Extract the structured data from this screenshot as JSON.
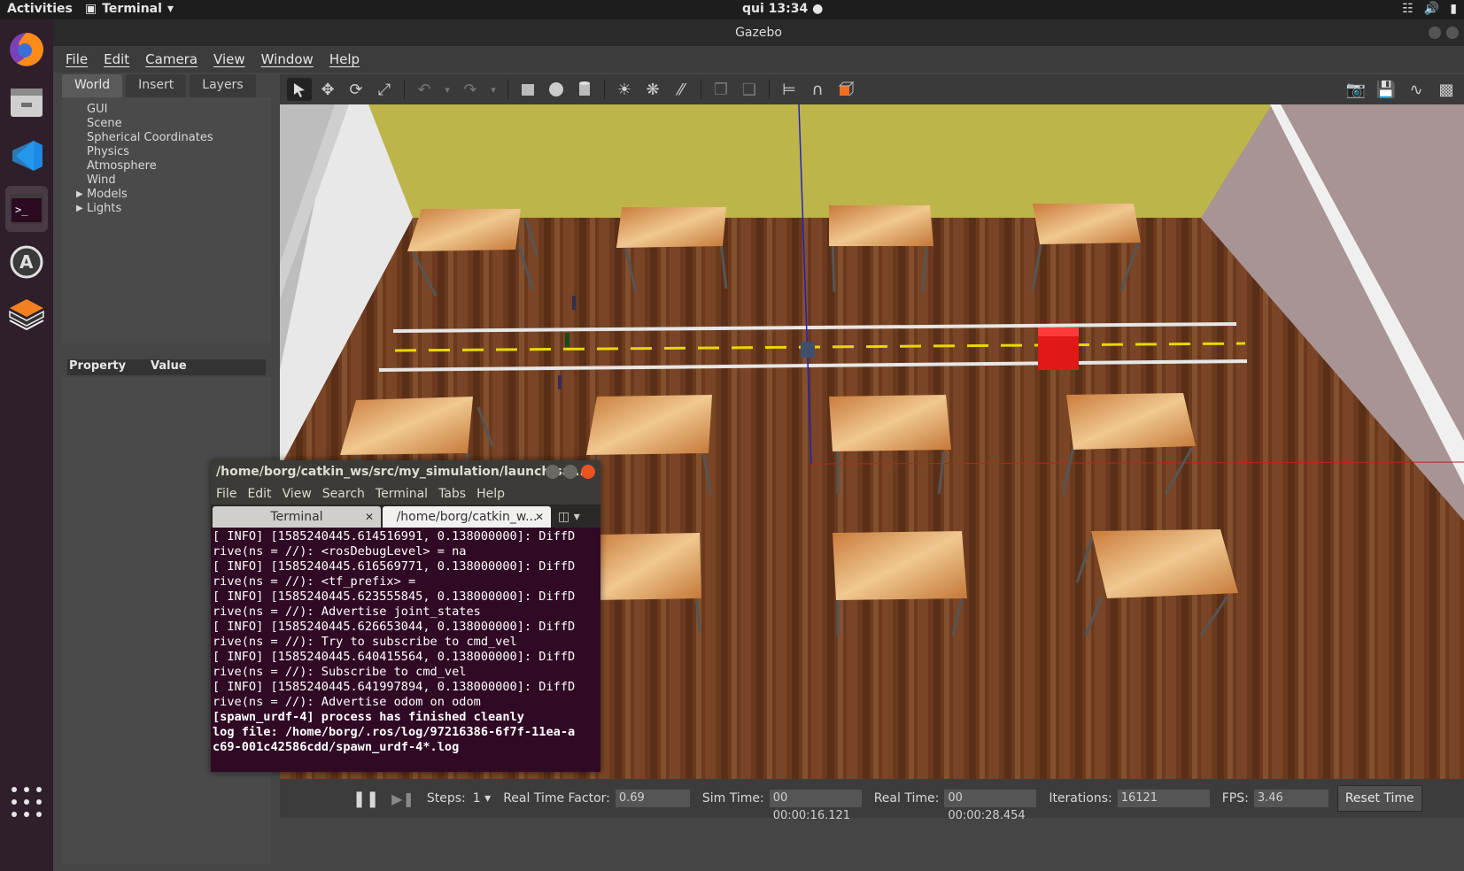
{
  "topbar": {
    "activities": "Activities",
    "app_menu": "Terminal",
    "clock": "qui 13:34"
  },
  "dock": {
    "apps": [
      {
        "name": "firefox-icon"
      },
      {
        "name": "files-icon"
      },
      {
        "name": "vscode-icon"
      },
      {
        "name": "terminal-icon"
      },
      {
        "name": "software-updater-icon"
      },
      {
        "name": "gazebo-icon"
      }
    ]
  },
  "gazebo": {
    "title": "Gazebo",
    "menu": [
      "File",
      "Edit",
      "Camera",
      "View",
      "Window",
      "Help"
    ],
    "tabs": [
      "World",
      "Insert",
      "Layers"
    ],
    "tree": [
      "GUI",
      "Scene",
      "Spherical Coordinates",
      "Physics",
      "Atmosphere",
      "Wind",
      "Models",
      "Lights"
    ],
    "property_header": {
      "property": "Property",
      "value": "Value"
    },
    "bottombar": {
      "steps_label": "Steps:",
      "steps_value": "1",
      "rtf_label": "Real Time Factor:",
      "rtf_value": "0.69",
      "sim_time_label": "Sim Time:",
      "sim_time_value": "00 00:00:16.121",
      "real_time_label": "Real Time:",
      "real_time_value": "00 00:00:28.454",
      "iterations_label": "Iterations:",
      "iterations_value": "16121",
      "fps_label": "FPS:",
      "fps_value": "3.46",
      "reset_label": "Reset Time"
    }
  },
  "terminal": {
    "title": "/home/borg/catkin_ws/src/my_simulation/launch/sal...",
    "menu": [
      "File",
      "Edit",
      "View",
      "Search",
      "Terminal",
      "Tabs",
      "Help"
    ],
    "tabs": [
      "Terminal",
      "/home/borg/catkin_w..."
    ],
    "lines": [
      "[ INFO] [1585240445.614516991, 0.138000000]: DiffD",
      "rive(ns = //): <rosDebugLevel> = na",
      "[ INFO] [1585240445.616569771, 0.138000000]: DiffD",
      "rive(ns = //): <tf_prefix> =",
      "[ INFO] [1585240445.623555845, 0.138000000]: DiffD",
      "rive(ns = //): Advertise joint_states",
      "[ INFO] [1585240445.626653044, 0.138000000]: DiffD",
      "rive(ns = //): Try to subscribe to cmd_vel",
      "[ INFO] [1585240445.640415564, 0.138000000]: DiffD",
      "rive(ns = //): Subscribe to cmd_vel",
      "[ INFO] [1585240445.641997894, 0.138000000]: DiffD",
      "rive(ns = //): Advertise odom on odom"
    ],
    "bold_lines": [
      "[spawn_urdf-4] process has finished cleanly",
      "log file: /home/borg/.ros/log/97216386-6f7f-11ea-a",
      "c69-001c42586cdd/spawn_urdf-4*.log"
    ]
  }
}
